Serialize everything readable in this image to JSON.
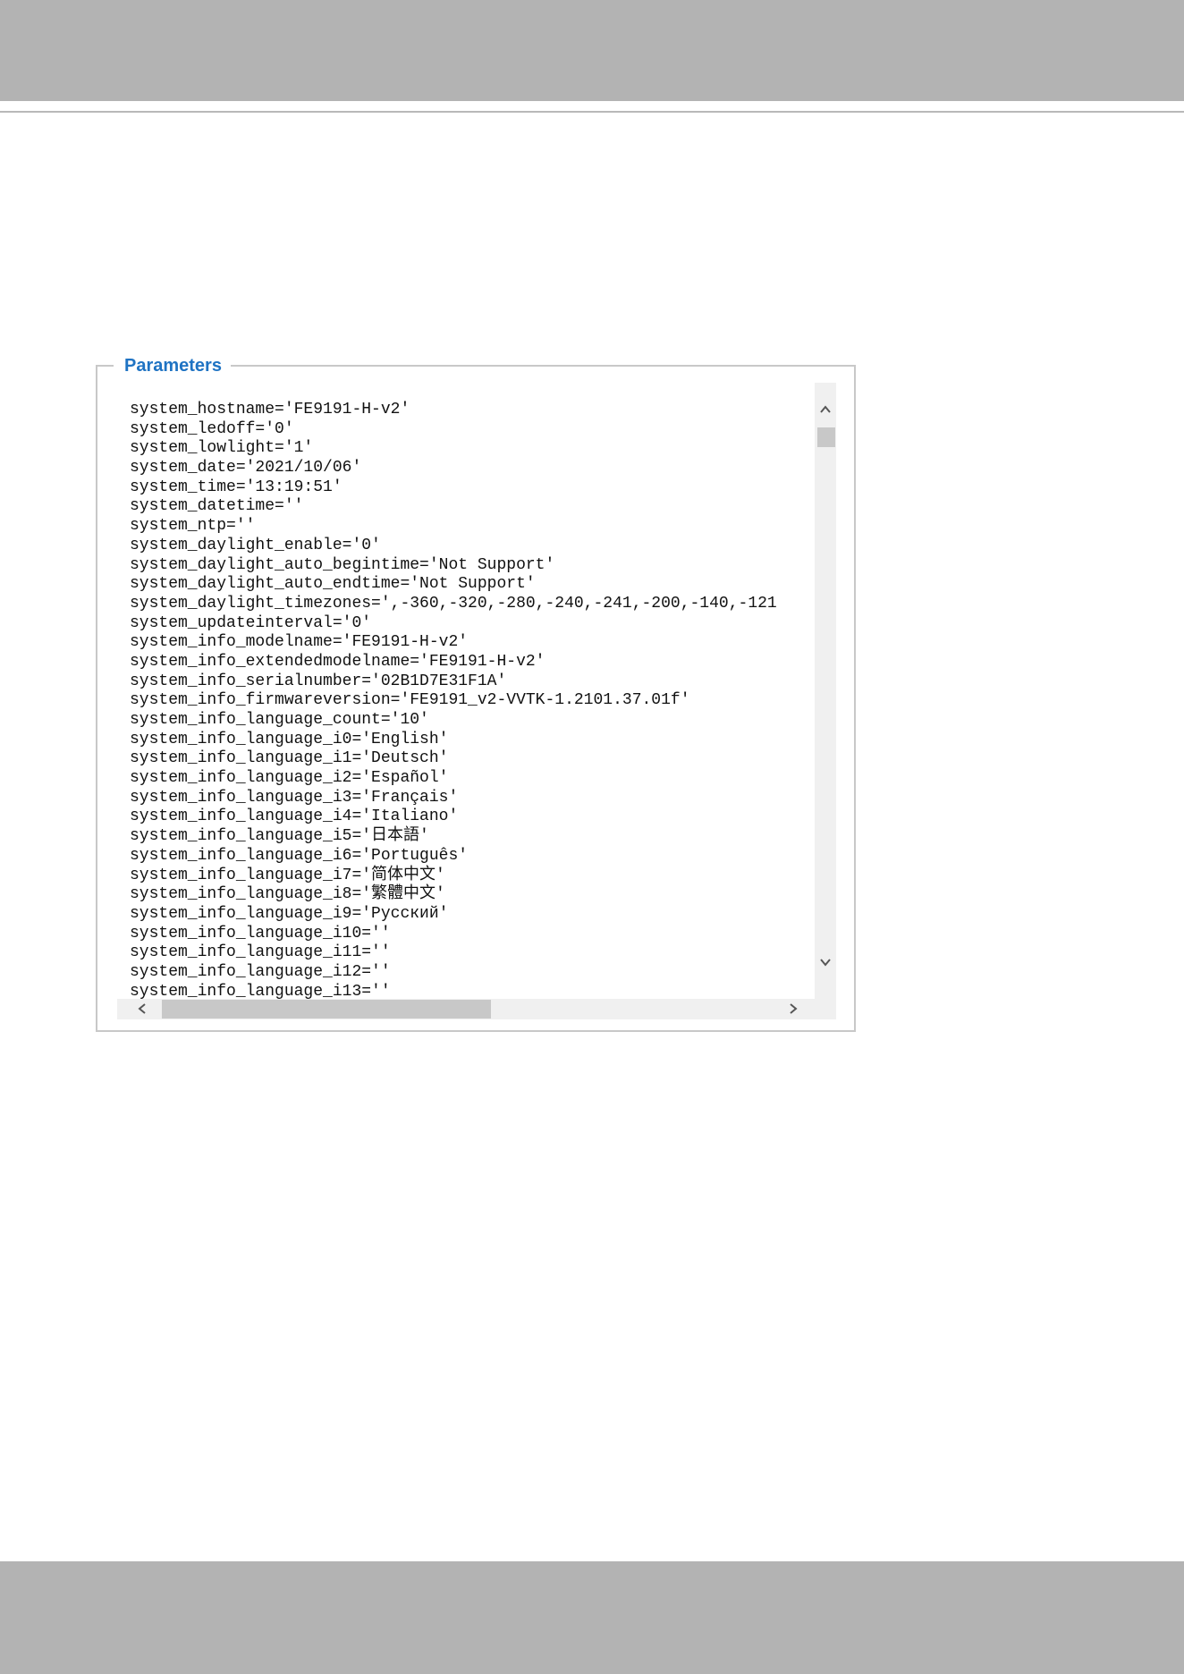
{
  "fieldset": {
    "legend": "Parameters"
  },
  "parameter_lines": [
    "system_hostname='FE9191-H-v2'",
    "system_ledoff='0'",
    "system_lowlight='1'",
    "system_date='2021/10/06'",
    "system_time='13:19:51'",
    "system_datetime=''",
    "system_ntp=''",
    "system_daylight_enable='0'",
    "system_daylight_auto_begintime='Not Support'",
    "system_daylight_auto_endtime='Not Support'",
    "system_daylight_timezones=',-360,-320,-280,-240,-241,-200,-140,-121",
    "system_updateinterval='0'",
    "system_info_modelname='FE9191-H-v2'",
    "system_info_extendedmodelname='FE9191-H-v2'",
    "system_info_serialnumber='02B1D7E31F1A'",
    "system_info_firmwareversion='FE9191_v2-VVTK-1.2101.37.01f'",
    "system_info_language_count='10'",
    "system_info_language_i0='English'",
    "system_info_language_i1='Deutsch'",
    "system_info_language_i2='Español'",
    "system_info_language_i3='Français'",
    "system_info_language_i4='Italiano'",
    "system_info_language_i5='日本語'",
    "system_info_language_i6='Português'",
    "system_info_language_i7='简体中文'",
    "system_info_language_i8='繁體中文'",
    "system_info_language_i9='Русский'",
    "system_info_language_i10=''",
    "system_info_language_i11=''",
    "system_info_language_i12=''",
    "system_info_language_i13=''"
  ],
  "icons": {
    "scroll_up": "chevron-up-icon",
    "scroll_down": "chevron-down-icon",
    "scroll_left": "chevron-left-icon",
    "scroll_right": "chevron-right-icon"
  },
  "colors": {
    "header_footer_bar": "#b3b3b3",
    "legend_text": "#1f73c3",
    "scrollbar_track": "#f0f0f0",
    "scrollbar_thumb": "#c8c8c8"
  },
  "scroll_state": {
    "vertical_position_fraction": 0.0,
    "horizontal_visible_fraction": 0.5
  }
}
